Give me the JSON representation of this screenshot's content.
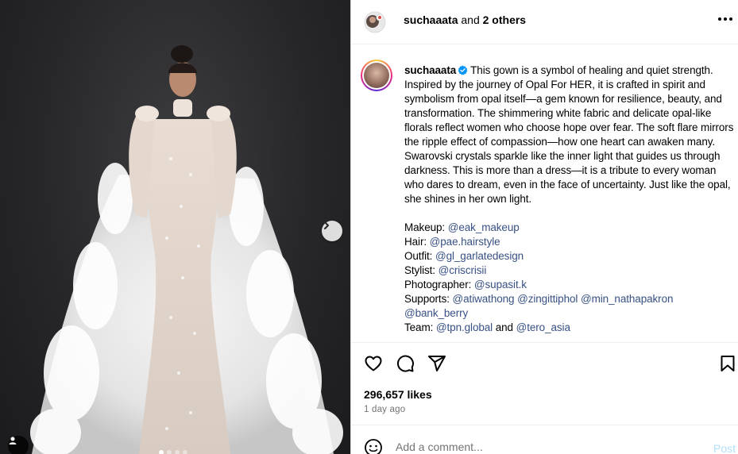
{
  "header": {
    "username": "suchaaata",
    "joiner": " and ",
    "others": "2 others"
  },
  "caption": {
    "username": "suchaaata",
    "body": "This gown is a symbol of healing and quiet strength. Inspired by the journey of Opal For HER, it is crafted in spirit and symbolism from opal itself—a gem known for resilience, beauty, and transformation. The shimmering white fabric and delicate opal-like florals reflect women who choose hope over fear. The soft flare mirrors the ripple effect of compassion—how one heart can awaken many. Swarovski crystals sparkle like the inner light that guides us through darkness. This is more than a dress—it is a tribute to every woman who dares to dream, even in the face of uncertainty. Just like the opal, she shines in her own light.",
    "credits": {
      "makeup_label": "Makeup:",
      "makeup": "@eak_makeup",
      "hair_label": "Hair:",
      "hair": "@pae.hairstyle",
      "outfit_label": "Outfit:",
      "outfit": "@gl_garlatedesign",
      "stylist_label": "Stylist:",
      "stylist": "@criscrisii",
      "photographer_label": "Photographer:",
      "photographer": "@supasit.k",
      "supports_label": "Supports:",
      "supports": [
        "@atiwathong",
        "@zingittiphol",
        "@min_nathapakron",
        "@bank_berry"
      ],
      "team_label": "Team:",
      "team": [
        "@tpn.global",
        "@tero_asia"
      ],
      "team_joiner": "and"
    }
  },
  "actions": {
    "likes": "296,657 likes",
    "time": "1 day ago"
  },
  "comment": {
    "placeholder": "Add a comment...",
    "post_label": "Post"
  },
  "colors": {
    "mention": "#385185",
    "post_disabled": "#b2dffc",
    "verified": "#0095f6"
  },
  "icons": [
    "heart-icon",
    "comment-icon",
    "share-icon",
    "bookmark-icon",
    "emoji-icon",
    "more-icon",
    "chevron-right-icon",
    "user-tag-icon",
    "verified-badge-icon"
  ],
  "carousel": {
    "slides": 4,
    "active": 1
  }
}
